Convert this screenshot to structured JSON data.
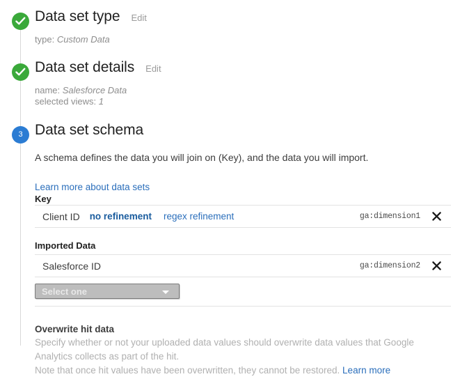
{
  "steps": [
    {
      "number": "1",
      "state": "complete",
      "title": "Data set type",
      "edit_label": "Edit",
      "summary": [
        {
          "label": "type:",
          "value": "Custom Data"
        }
      ]
    },
    {
      "number": "2",
      "state": "complete",
      "title": "Data set details",
      "edit_label": "Edit",
      "summary": [
        {
          "label": "name:",
          "value": "Salesforce Data"
        },
        {
          "label": "selected views:",
          "value": "1"
        }
      ]
    },
    {
      "number": "3",
      "state": "active",
      "title": "Data set schema",
      "description": "A schema defines the data you will join on (Key), and the data you will import.",
      "learn_more_label": "Learn more about data sets"
    }
  ],
  "schema": {
    "key_label": "Key",
    "key_rows": [
      {
        "name": "Client ID",
        "refinement_selected": "no refinement",
        "refinement_other": "regex refinement",
        "dimension": "ga:dimension1",
        "remove_icon": "close-icon"
      }
    ],
    "imported_label": "Imported Data",
    "imported_rows": [
      {
        "name": "Salesforce ID",
        "dimension": "ga:dimension2",
        "remove_icon": "close-icon"
      }
    ],
    "add_select_placeholder": "Select one"
  },
  "overwrite": {
    "title": "Overwrite hit data",
    "paragraph": "Specify whether or not your uploaded data values should overwrite data values that Google Analytics collects as part of the hit.",
    "note": "Note that once hit values have been overwritten, they cannot be restored.",
    "learn_more_label": "Learn more"
  },
  "colors": {
    "complete": "#3aa93a",
    "active": "#2b7cd3",
    "link": "#2a6ebb",
    "muted": "#b0b0b0"
  }
}
